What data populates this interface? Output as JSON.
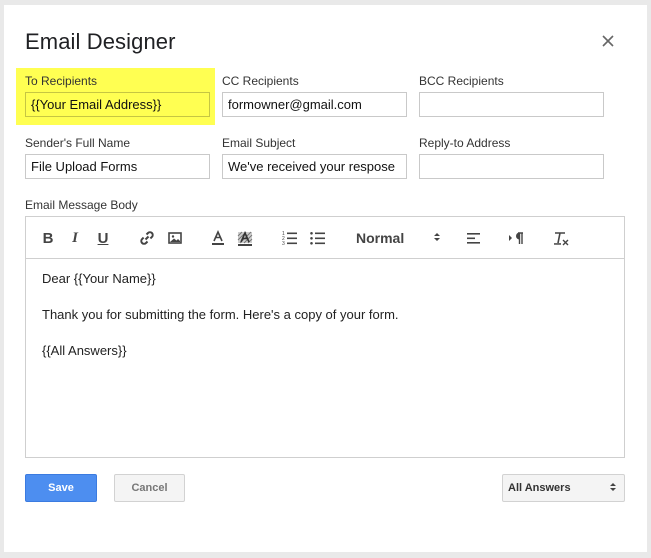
{
  "dialog": {
    "title": "Email Designer",
    "close_icon": "close-icon"
  },
  "fields": {
    "to_recipients": {
      "label": "To Recipients",
      "value": "{{Your Email Address}}"
    },
    "cc_recipients": {
      "label": "CC Recipients",
      "value": "formowner@gmail.com"
    },
    "bcc_recipients": {
      "label": "BCC Recipients",
      "value": ""
    },
    "sender_name": {
      "label": "Sender's Full Name",
      "value": "File Upload Forms"
    },
    "email_subject": {
      "label": "Email Subject",
      "value": "We've received your respose"
    },
    "reply_to": {
      "label": "Reply-to Address",
      "value": ""
    }
  },
  "message": {
    "label": "Email Message Body",
    "toolbar": {
      "bold": "B",
      "italic": "I",
      "underline": "U",
      "format_value": "Normal",
      "icons": [
        "bold-icon",
        "italic-icon",
        "underline-icon",
        "link-icon",
        "image-icon",
        "text-color-icon",
        "background-color-icon",
        "ordered-list-icon",
        "bullet-list-icon",
        "align-icon",
        "text-direction-icon",
        "clear-format-icon"
      ]
    },
    "body_lines": [
      "Dear {{Your Name}}",
      "Thank you for submitting the form. Here's a copy of your form.",
      "{{All Answers}}"
    ]
  },
  "footer": {
    "save_label": "Save",
    "cancel_label": "Cancel",
    "insert_select_value": "All Answers"
  },
  "colors": {
    "highlight": "#ffff52",
    "save_button": "#4d8ef0"
  }
}
